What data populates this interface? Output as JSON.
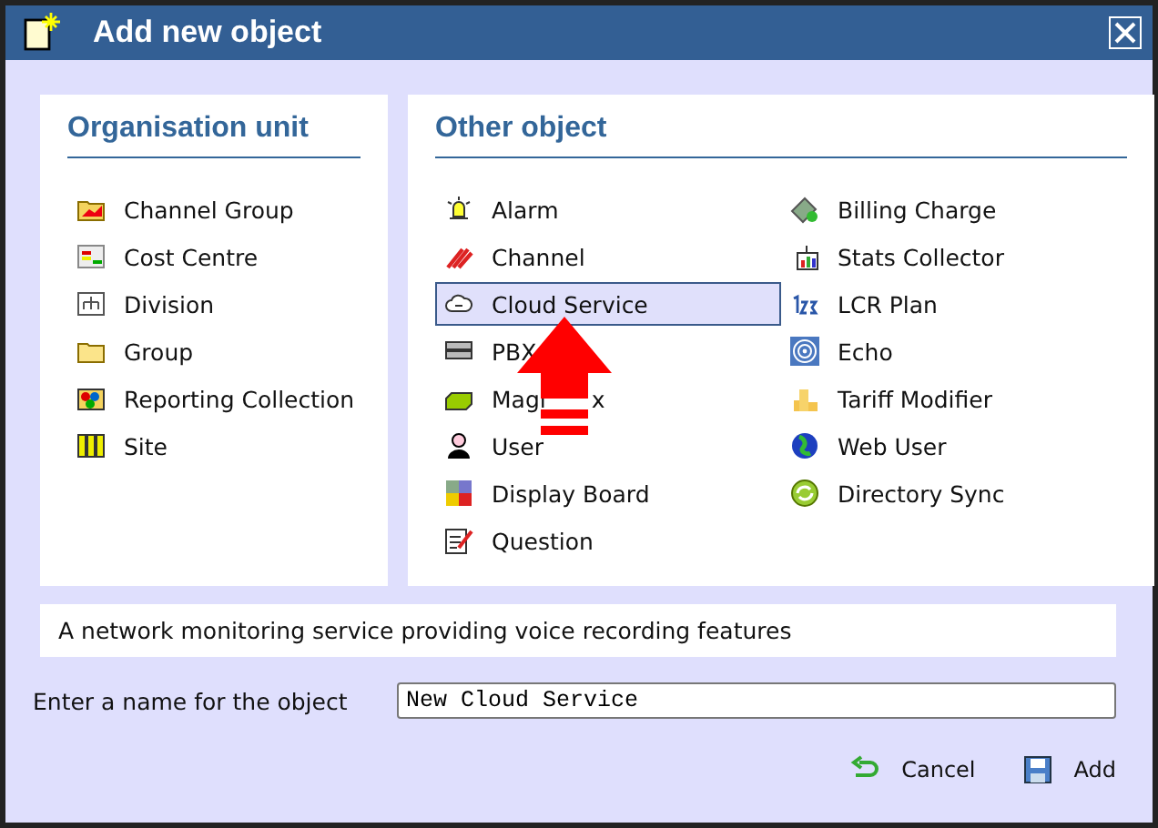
{
  "window": {
    "title": "Add new object"
  },
  "organisation_unit": {
    "heading": "Organisation unit",
    "items": [
      {
        "label": "Channel Group",
        "kind": "channelgroup",
        "selected": false
      },
      {
        "label": "Cost Centre",
        "kind": "costcentre",
        "selected": false
      },
      {
        "label": "Division",
        "kind": "division",
        "selected": false
      },
      {
        "label": "Group",
        "kind": "folder",
        "selected": false
      },
      {
        "label": "Reporting Collection",
        "kind": "collection",
        "selected": false
      },
      {
        "label": "Site",
        "kind": "site",
        "selected": false
      }
    ]
  },
  "other_object": {
    "heading": "Other object",
    "columns": [
      [
        {
          "label": "Alarm",
          "kind": "alarm",
          "selected": false
        },
        {
          "label": "Channel",
          "kind": "channel",
          "selected": false
        },
        {
          "label": "Cloud Service",
          "kind": "cloud",
          "selected": true
        },
        {
          "label": "PBX",
          "kind": "pbx",
          "selected": false
        },
        {
          "label": "Magi",
          "label_end": "x",
          "kind": "magicbox",
          "selected": false
        },
        {
          "label": "User",
          "kind": "user",
          "selected": false
        },
        {
          "label": "Display Board",
          "kind": "board",
          "selected": false
        },
        {
          "label": "Question",
          "kind": "question",
          "selected": false
        }
      ],
      [
        {
          "label": "Billing Charge",
          "kind": "billing",
          "selected": false
        },
        {
          "label": "Stats Collector",
          "kind": "stats",
          "selected": false
        },
        {
          "label": "LCR Plan",
          "kind": "lcr",
          "selected": false
        },
        {
          "label": "Echo",
          "kind": "echo",
          "selected": false
        },
        {
          "label": "Tariff Modifier",
          "kind": "tariff",
          "selected": false
        },
        {
          "label": "Web User",
          "kind": "globe",
          "selected": false
        },
        {
          "label": "Directory Sync",
          "kind": "sync",
          "selected": false
        }
      ]
    ]
  },
  "description": "A network monitoring service providing voice recording features",
  "name_field": {
    "label": "Enter a name for the object",
    "value": "New Cloud Service"
  },
  "buttons": [
    {
      "label": "Cancel",
      "kind": "cancel"
    },
    {
      "label": "Add",
      "kind": "add"
    }
  ]
}
